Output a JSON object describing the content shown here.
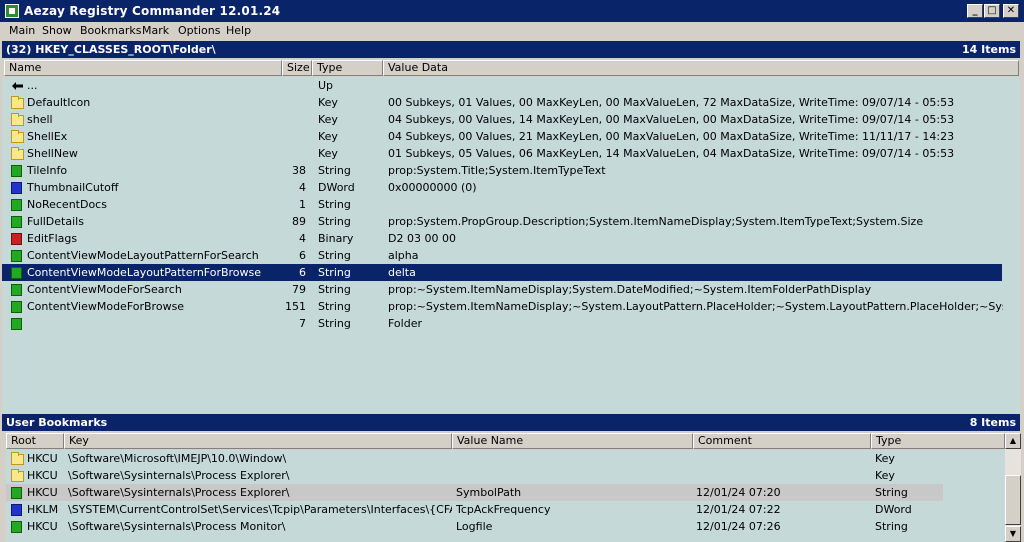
{
  "window": {
    "title": "Aezay Registry Commander 12.01.24",
    "min_label": "_",
    "max_label": "□",
    "close_label": "✕"
  },
  "menu": [
    "Main",
    "Show",
    "Bookmarks",
    "Mark",
    "Options",
    "Help"
  ],
  "registry": {
    "path": "(32) HKEY_CLASSES_ROOT\\Folder\\",
    "count": "14 Items",
    "columns": [
      "Name",
      "Size",
      "Type",
      "Value Data"
    ],
    "rows": [
      {
        "icon": "up-icon",
        "name": "...",
        "size": "",
        "type": "Up",
        "data": ""
      },
      {
        "icon": "folder-icon",
        "name": "DefaultIcon",
        "size": "",
        "type": "Key",
        "data": "00 Subkeys, 01 Values, 00 MaxKeyLen, 00 MaxValueLen, 72 MaxDataSize, WriteTime: 09/07/14 - 05:53"
      },
      {
        "icon": "folder-icon",
        "name": "shell",
        "size": "",
        "type": "Key",
        "data": "04 Subkeys, 00 Values, 14 MaxKeyLen, 00 MaxValueLen, 00 MaxDataSize, WriteTime: 09/07/14 - 05:53"
      },
      {
        "icon": "folder-icon",
        "name": "ShellEx",
        "size": "",
        "type": "Key",
        "data": "04 Subkeys, 00 Values, 21 MaxKeyLen, 00 MaxValueLen, 00 MaxDataSize, WriteTime: 11/11/17 - 14:23"
      },
      {
        "icon": "folder-icon",
        "name": "ShellNew",
        "size": "",
        "type": "Key",
        "data": "01 Subkeys, 05 Values, 06 MaxKeyLen, 14 MaxValueLen, 04 MaxDataSize, WriteTime: 09/07/14 - 05:53"
      },
      {
        "icon": "string-value-icon",
        "name": "TileInfo",
        "size": "38",
        "type": "String",
        "data": "prop:System.Title;System.ItemTypeText"
      },
      {
        "icon": "dword-value-icon",
        "name": "ThumbnailCutoff",
        "size": "4",
        "type": "DWord",
        "data": "0x00000000 (0)"
      },
      {
        "icon": "string-value-icon",
        "name": "NoRecentDocs",
        "size": "1",
        "type": "String",
        "data": ""
      },
      {
        "icon": "string-value-icon",
        "name": "FullDetails",
        "size": "89",
        "type": "String",
        "data": "prop:System.PropGroup.Description;System.ItemNameDisplay;System.ItemTypeText;System.Size"
      },
      {
        "icon": "binary-value-icon",
        "name": "EditFlags",
        "size": "4",
        "type": "Binary",
        "data": "D2 03 00 00"
      },
      {
        "icon": "string-value-icon",
        "name": "ContentViewModeLayoutPatternForSearch",
        "size": "6",
        "type": "String",
        "data": "alpha"
      },
      {
        "icon": "string-value-icon",
        "name": "ContentViewModeLayoutPatternForBrowse",
        "size": "6",
        "type": "String",
        "data": "delta",
        "selected": true
      },
      {
        "icon": "string-value-icon",
        "name": "ContentViewModeForSearch",
        "size": "79",
        "type": "String",
        "data": "prop:~System.ItemNameDisplay;System.DateModified;~System.ItemFolderPathDisplay"
      },
      {
        "icon": "string-value-icon",
        "name": "ContentViewModeForBrowse",
        "size": "151",
        "type": "String",
        "data": "prop:~System.ItemNameDisplay;~System.LayoutPattern.PlaceHolder;~System.LayoutPattern.PlaceHolder;~System.Layout..."
      },
      {
        "icon": "string-value-icon",
        "name": "",
        "size": "7",
        "type": "String",
        "data": "Folder"
      }
    ]
  },
  "bookmarks": {
    "title": "User Bookmarks",
    "count": "8 Items",
    "columns": [
      "Root",
      "Key",
      "Value Name",
      "Comment",
      "Type"
    ],
    "rows": [
      {
        "icon": "folder-icon",
        "root": "HKCU",
        "key": "\\Software\\Microsoft\\IMEJP\\10.0\\Window\\",
        "value": "",
        "comment": "",
        "type": "Key"
      },
      {
        "icon": "folder-icon",
        "root": "HKCU",
        "key": "\\Software\\Sysinternals\\Process Explorer\\",
        "value": "",
        "comment": "",
        "type": "Key"
      },
      {
        "icon": "string-value-icon",
        "root": "HKCU",
        "key": "\\Software\\Sysinternals\\Process Explorer\\",
        "value": "SymbolPath",
        "comment": "12/01/24 07:20",
        "type": "String",
        "highlighted": true
      },
      {
        "icon": "dword-value-icon",
        "root": "HKLM",
        "key": "\\SYSTEM\\CurrentControlSet\\Services\\Tcpip\\Parameters\\Interfaces\\{CFABD...",
        "value": "TcpAckFrequency",
        "comment": "12/01/24 07:22",
        "type": "DWord"
      },
      {
        "icon": "string-value-icon",
        "root": "HKCU",
        "key": "\\Software\\Sysinternals\\Process Monitor\\",
        "value": "Logfile",
        "comment": "12/01/24 07:26",
        "type": "String"
      }
    ]
  },
  "scrollbar": {
    "up": "▲",
    "down": "▼"
  }
}
